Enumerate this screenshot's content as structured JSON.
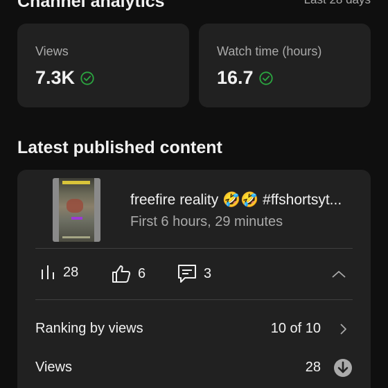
{
  "header": {
    "title": "Channel analytics",
    "range": "Last 28 days"
  },
  "stats": [
    {
      "label": "Views",
      "value": "7.3K",
      "icon": "check-circle-icon"
    },
    {
      "label": "Watch time (hours)",
      "value": "16.7",
      "icon": "check-circle-icon"
    }
  ],
  "colors": {
    "background": "#0f0f0f",
    "card": "#212121",
    "check_green": "#2ba640",
    "secondary_text": "#aaaaaa"
  },
  "latest": {
    "section_title": "Latest published content",
    "video": {
      "title": "freefire reality 🤣🤣 #ffshortsyt...",
      "subtitle": "First 6 hours, 29 minutes"
    },
    "metrics": {
      "views": "28",
      "likes": "6",
      "comments": "3"
    },
    "rows": [
      {
        "label": "Ranking by views",
        "value": "10 of 10",
        "icon": "chevron-right-icon"
      },
      {
        "label": "Views",
        "value": "28",
        "icon": "arrow-down-circle-icon"
      }
    ]
  }
}
